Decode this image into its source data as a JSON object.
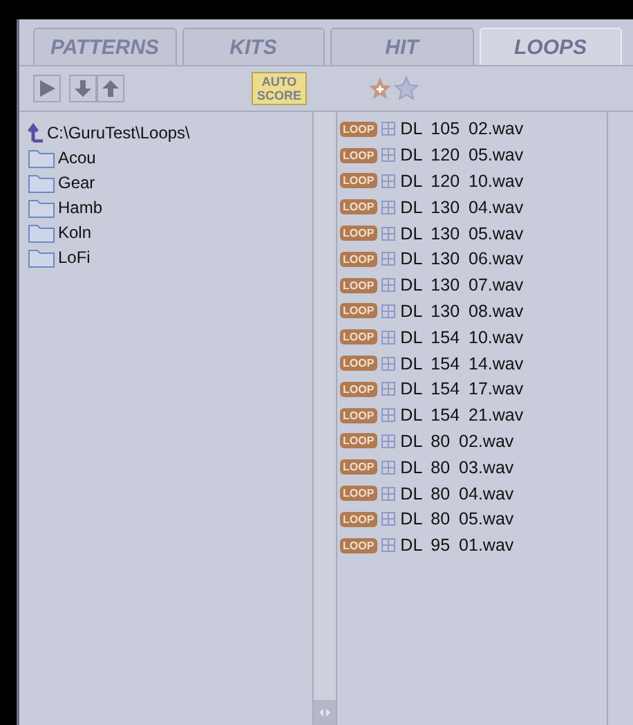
{
  "tabs": [
    {
      "label": "PATTERNS",
      "selected": false
    },
    {
      "label": "KITS",
      "selected": false
    },
    {
      "label": "HIT",
      "selected": false
    },
    {
      "label": "LOOPS",
      "selected": true
    }
  ],
  "toolbar": {
    "auto_score": [
      "AUTO",
      "SCORE"
    ]
  },
  "folders": {
    "path": "C:\\GuruTest\\Loops\\",
    "items": [
      "Acou",
      "Gear",
      "Hamb",
      "Koln",
      "LoFi"
    ]
  },
  "files": [
    {
      "badge": "LOOP",
      "name": "DL 105 02.wav"
    },
    {
      "badge": "LOOP",
      "name": "DL 120 05.wav"
    },
    {
      "badge": "LOOP",
      "name": "DL 120 10.wav"
    },
    {
      "badge": "LOOP",
      "name": "DL 130 04.wav"
    },
    {
      "badge": "LOOP",
      "name": "DL 130 05.wav"
    },
    {
      "badge": "LOOP",
      "name": "DL 130 06.wav"
    },
    {
      "badge": "LOOP",
      "name": "DL 130 07.wav"
    },
    {
      "badge": "LOOP",
      "name": "DL 130 08.wav"
    },
    {
      "badge": "LOOP",
      "name": "DL 154 10.wav"
    },
    {
      "badge": "LOOP",
      "name": "DL 154 14.wav"
    },
    {
      "badge": "LOOP",
      "name": "DL 154 17.wav"
    },
    {
      "badge": "LOOP",
      "name": "DL 154 21.wav"
    },
    {
      "badge": "LOOP",
      "name": "DL 80 02.wav"
    },
    {
      "badge": "LOOP",
      "name": "DL 80 03.wav"
    },
    {
      "badge": "LOOP",
      "name": "DL 80 04.wav"
    },
    {
      "badge": "LOOP",
      "name": "DL 80 05.wav"
    },
    {
      "badge": "LOOP",
      "name": "DL 95 01.wav"
    }
  ]
}
